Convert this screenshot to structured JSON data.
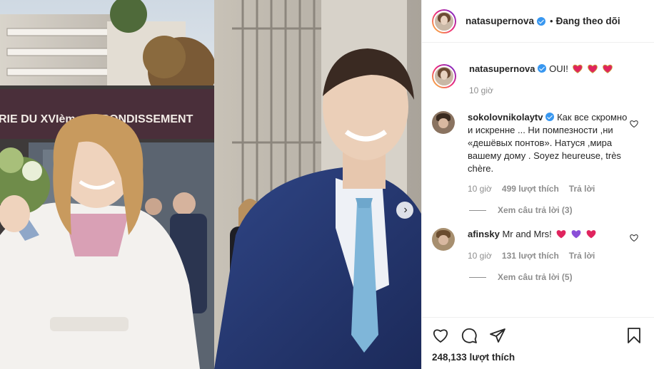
{
  "post": {
    "author": "natasupernova",
    "follow_status": "Đang theo dõi",
    "caption_author": "natasupernova",
    "caption_text": "OUI!",
    "caption_time": "10 giờ",
    "likes": "248,133 lượt thích"
  },
  "photo_sign": {
    "text": "RIE DU XVIème ARRONDISSEMENT"
  },
  "comments": [
    {
      "author": "sokolovnikolaytv",
      "text": "Как все скромно и искренне ... Ни помпезности ,ни «дешёвых понтов». Натуся ,мира вашему дому . Soyez heureuse, très chère.",
      "time": "10 giờ",
      "likes": "499 lượt thích",
      "reply": "Trả lời",
      "view_replies": "Xem câu trả lời (3)"
    },
    {
      "author": "afinsky",
      "text": "Mr and Mrs!",
      "time": "10 giờ",
      "likes": "131 lượt thích",
      "reply": "Trả lời",
      "view_replies": "Xem câu trả lời (5)"
    }
  ],
  "colors": {
    "verified": "#3897f0",
    "heart_red": "#e0245e",
    "heart_purple": "#8a4fd8",
    "secondary_text": "#8e8e8e"
  },
  "icons": [
    "verified-badge-icon",
    "heart-icon",
    "comment-icon",
    "share-icon",
    "bookmark-icon",
    "chevron-right-icon"
  ]
}
